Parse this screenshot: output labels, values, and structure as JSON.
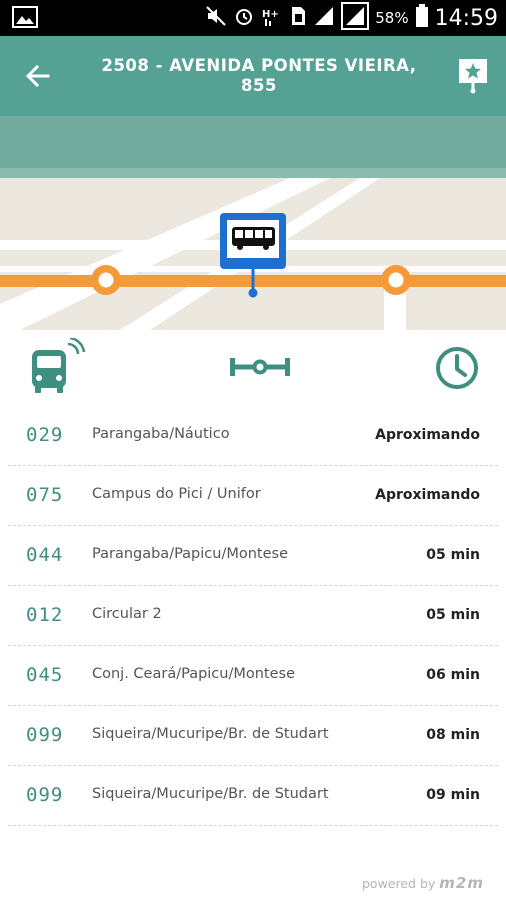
{
  "status_bar": {
    "battery_percent": "58%",
    "time": "14:59"
  },
  "toolbar": {
    "title": "2508 - AVENIDA PONTES VIEIRA, 855",
    "colors": {
      "background": "#55a193",
      "text": "#ffffff"
    }
  },
  "tabs": [
    {
      "icon": "bus-realtime-icon",
      "active": true
    },
    {
      "icon": "route-icon",
      "active": false
    },
    {
      "icon": "clock-icon",
      "active": false
    }
  ],
  "arrivals": [
    {
      "code": "029",
      "name": "Parangaba/Náutico",
      "eta": "Aproximando"
    },
    {
      "code": "075",
      "name": "Campus do Pici / Unifor",
      "eta": "Aproximando"
    },
    {
      "code": "044",
      "name": "Parangaba/Papicu/Montese",
      "eta": "05 min"
    },
    {
      "code": "012",
      "name": "Circular 2",
      "eta": "05 min"
    },
    {
      "code": "045",
      "name": "Conj. Ceará/Papicu/Montese",
      "eta": "06 min"
    },
    {
      "code": "099",
      "name": "Siqueira/Mucuripe/Br. de Studart",
      "eta": "08 min"
    },
    {
      "code": "099",
      "name": "Siqueira/Mucuripe/Br. de Studart",
      "eta": "09 min"
    }
  ],
  "footer": {
    "powered_by": "powered by",
    "brand": "m2m"
  },
  "colors": {
    "accent": "#3f8f80",
    "route_line": "#f59a38",
    "stop_marker": "#1e6fd0"
  }
}
